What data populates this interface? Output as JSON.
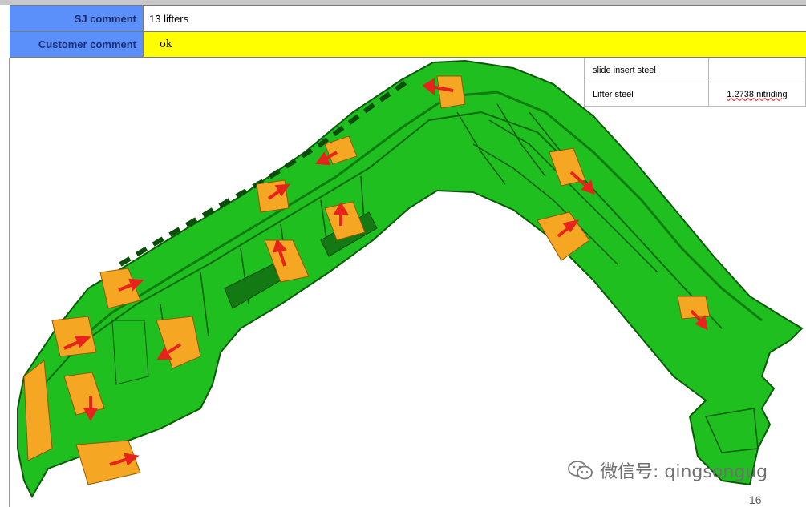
{
  "table": {
    "sj_label": "SJ comment",
    "sj_value": "13 lifters",
    "customer_label": "Customer comment",
    "customer_value": "ok"
  },
  "steel_table": {
    "r1c1": "slide insert steel",
    "r1c2": "",
    "r2c1": "Lifter   steel",
    "r2c2": "1.2738 nitriding"
  },
  "watermark": {
    "text": "微信号: qingsongug",
    "icon": "wechat-icon"
  },
  "page_number": "16",
  "colors": {
    "header_blue": "#5b8ff9",
    "highlight_yellow": "#ffff00",
    "part_green": "#1fbf1f",
    "lifter_orange": "#f5a623",
    "arrow_red": "#e8231c"
  }
}
